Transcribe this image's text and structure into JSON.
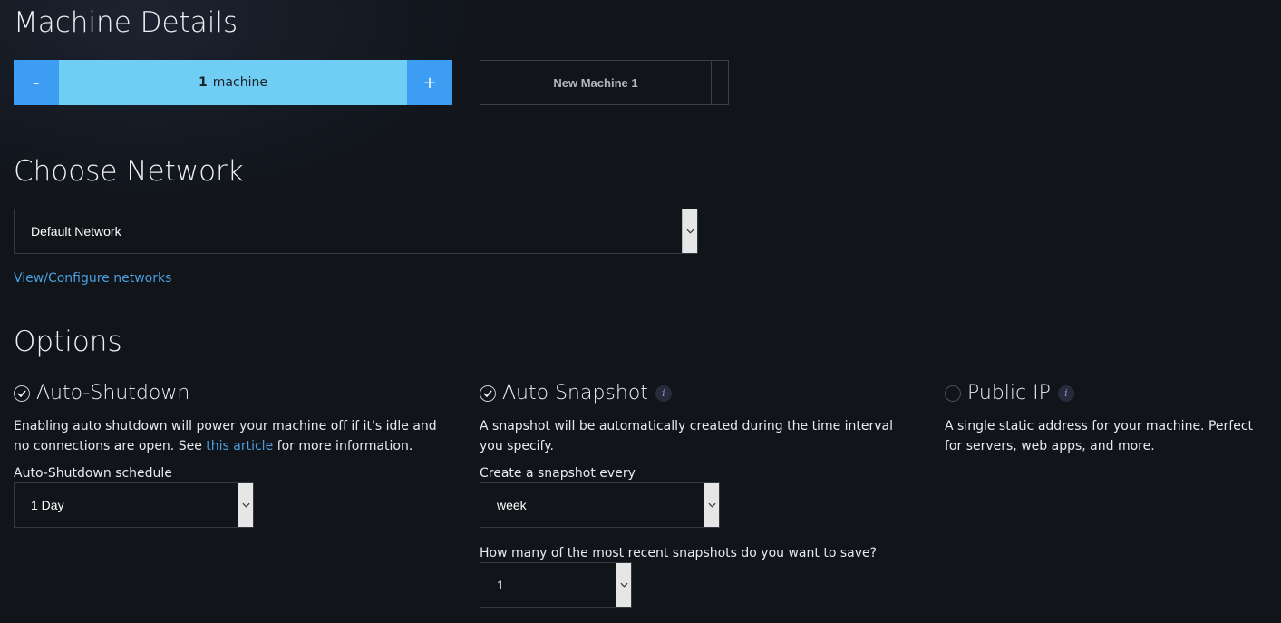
{
  "machine_details": {
    "title": "Machine Details",
    "decrement_label": "-",
    "increment_label": "+",
    "count": "1",
    "count_unit": "machine",
    "machine_name": "New Machine 1"
  },
  "network": {
    "title": "Choose Network",
    "selected": "Default Network",
    "configure_link": "View/Configure networks"
  },
  "options": {
    "title": "Options",
    "auto_shutdown": {
      "checked": true,
      "title": "Auto-Shutdown",
      "desc_before": "Enabling auto shutdown will power your machine off if it's idle and no connections are open. See ",
      "desc_link": "this article",
      "desc_after": " for more information.",
      "schedule_label": "Auto-Shutdown schedule",
      "schedule_value": "1 Day"
    },
    "auto_snapshot": {
      "checked": true,
      "title": "Auto Snapshot",
      "info_icon": "i",
      "desc": "A snapshot will be automatically created during the time interval you specify.",
      "interval_label": "Create a snapshot every",
      "interval_value": "week",
      "keep_label": "How many of the most recent snapshots do you want to save?",
      "keep_value": "1"
    },
    "public_ip": {
      "checked": false,
      "title": "Public IP",
      "info_icon": "i",
      "desc": "A single static address for your machine. Perfect for servers, web apps, and more."
    }
  },
  "colors": {
    "accent_blue": "#3c9df2",
    "counter_fill": "#70cdf3",
    "link": "#4a9fe0",
    "background": "#111419"
  }
}
